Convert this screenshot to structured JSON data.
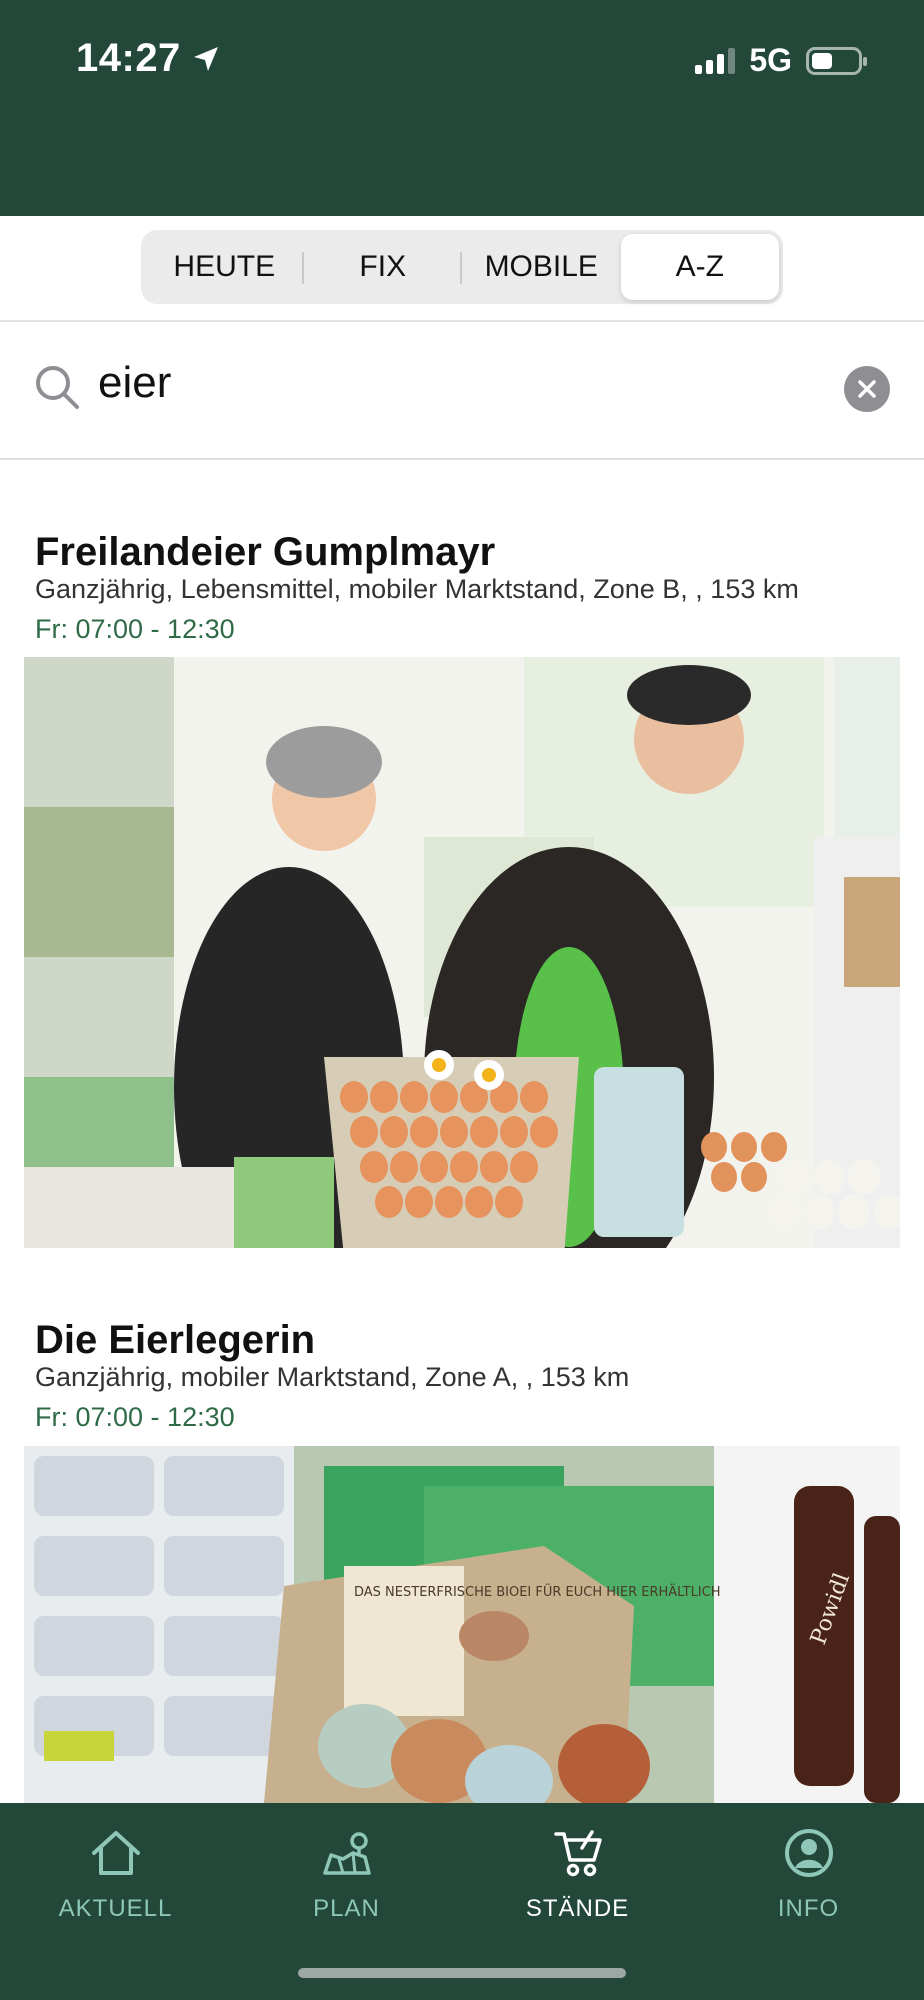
{
  "status": {
    "time": "14:27",
    "network": "5G"
  },
  "tabs": [
    {
      "label": "HEUTE",
      "active": false
    },
    {
      "label": "FIX",
      "active": false
    },
    {
      "label": "MOBILE",
      "active": false
    },
    {
      "label": "A-Z",
      "active": true
    }
  ],
  "search": {
    "value": "eier",
    "icon": "search-icon",
    "clear_icon": "clear-icon"
  },
  "results": [
    {
      "title": "Freilandeier Gumplmayr",
      "meta": "Ganzjährig, Lebensmittel, mobiler Marktstand, Zone B, , 153 km",
      "hours": "Fr: 07:00 - 12:30"
    },
    {
      "title": "Die Eierlegerin",
      "meta": "Ganzjährig, mobiler Marktstand, Zone A, , 153 km",
      "hours": "Fr: 07:00 - 12:30"
    }
  ],
  "image_text": {
    "sign": "DAS NESTERFRISCHE BIOEI FÜR EUCH HIER ERHÄLTLICH",
    "jar": "Powidl"
  },
  "nav": [
    {
      "label": "AKTUELL",
      "icon": "home-icon",
      "active": false
    },
    {
      "label": "PLAN",
      "icon": "map-icon",
      "active": false
    },
    {
      "label": "STÄNDE",
      "icon": "cart-icon",
      "active": true
    },
    {
      "label": "INFO",
      "icon": "user-icon",
      "active": false
    }
  ],
  "colors": {
    "brand": "#234739",
    "accent_text": "#2f6b47",
    "nav_inactive": "#8ec7b8"
  }
}
